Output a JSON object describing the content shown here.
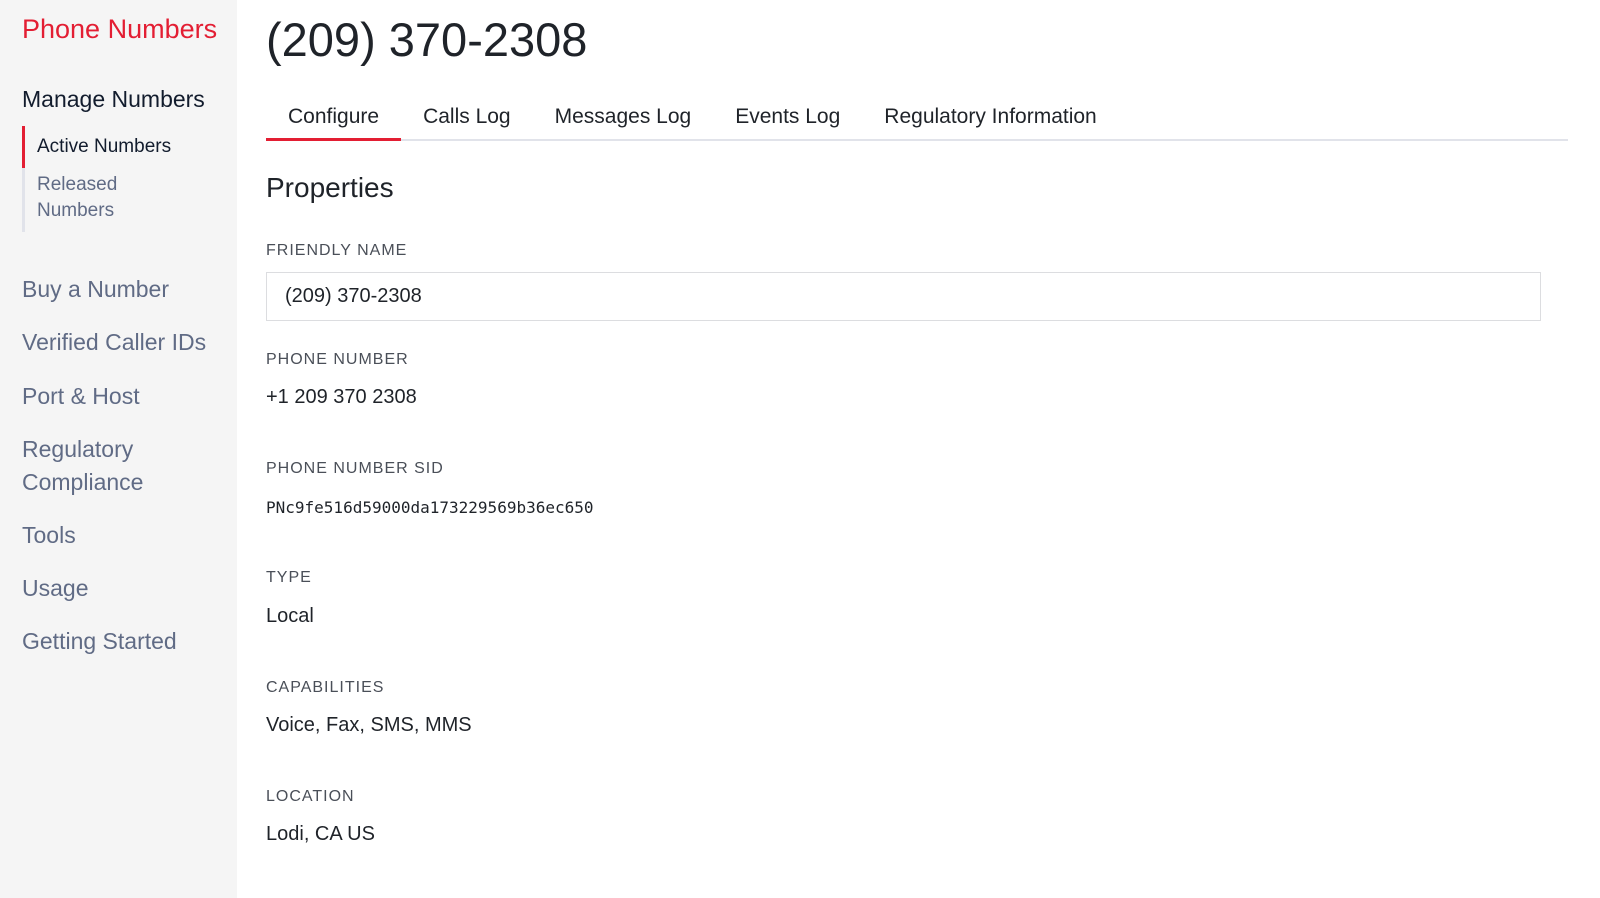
{
  "sidebar": {
    "brand": "Phone Numbers",
    "section": "Manage Numbers",
    "sub_items": [
      "Active Numbers",
      "Released Numbers"
    ],
    "items": [
      "Buy a Number",
      "Verified Caller IDs",
      "Port & Host",
      "Regulatory Compliance",
      "Tools",
      "Usage",
      "Getting Started"
    ]
  },
  "header": {
    "title": "(209) 370-2308"
  },
  "tabs": [
    "Configure",
    "Calls Log",
    "Messages Log",
    "Events Log",
    "Regulatory Information"
  ],
  "main": {
    "heading": "Properties",
    "friendly_name_label": "FRIENDLY NAME",
    "friendly_name_value": "(209) 370-2308",
    "phone_label": "PHONE NUMBER",
    "phone_value": "+1 209 370 2308",
    "sid_label": "PHONE NUMBER SID",
    "sid_value": "PNc9fe516d59000da173229569b36ec650",
    "type_label": "TYPE",
    "type_value": "Local",
    "cap_label": "CAPABILITIES",
    "cap_value": "Voice, Fax, SMS, MMS",
    "loc_label": "LOCATION",
    "loc_value": "Lodi, CA US"
  },
  "colors": {
    "accent": "#e31e33",
    "sidebar_bg": "#f5f5f5"
  }
}
